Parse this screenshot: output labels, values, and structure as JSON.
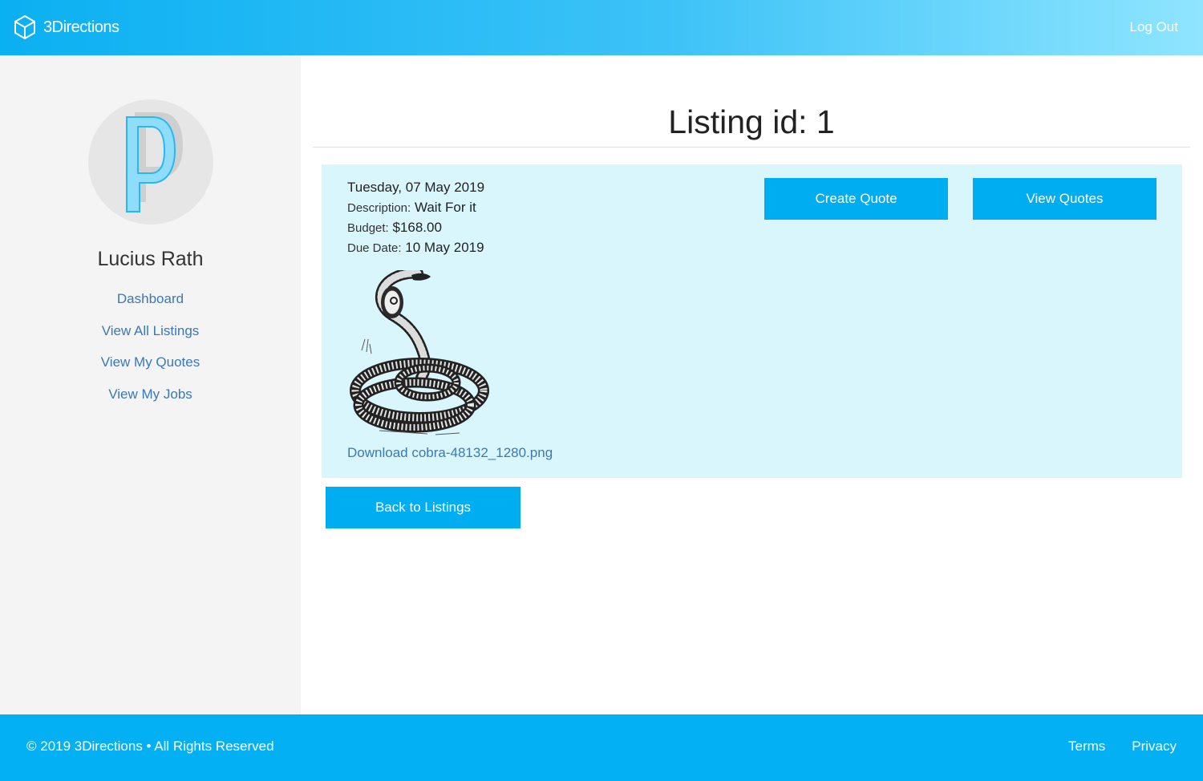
{
  "header": {
    "brand_name": "3Directions",
    "logout_label": "Log Out"
  },
  "sidebar": {
    "user_name": "Lucius Rath",
    "avatar_letter": "P",
    "nav": [
      {
        "label": "Dashboard"
      },
      {
        "label": "View All Listings"
      },
      {
        "label": "View My Quotes"
      },
      {
        "label": "View My Jobs"
      }
    ]
  },
  "main": {
    "title": "Listing id: 1",
    "listing": {
      "date": "Tuesday, 07 May 2019",
      "description_label": "Description:",
      "description_value": "Wait For it",
      "budget_label": "Budget:",
      "budget_value": "$168.00",
      "due_label": "Due Date:",
      "due_value": "10 May 2019",
      "image_icon": "cobra-illustration",
      "download_label": "Download cobra-48132_1280.png"
    },
    "buttons": {
      "create_quote": "Create Quote",
      "view_quotes": "View Quotes",
      "back": "Back to Listings"
    }
  },
  "footer": {
    "copyright": "© 2019 3Directions • All Rights Reserved",
    "links": [
      {
        "label": "Terms"
      },
      {
        "label": "Privacy"
      }
    ]
  },
  "colors": {
    "primary": "#00adf1",
    "card_bg": "#daf6fd",
    "link": "#3a78b7",
    "sidebar_bg": "#f4f4f4"
  }
}
